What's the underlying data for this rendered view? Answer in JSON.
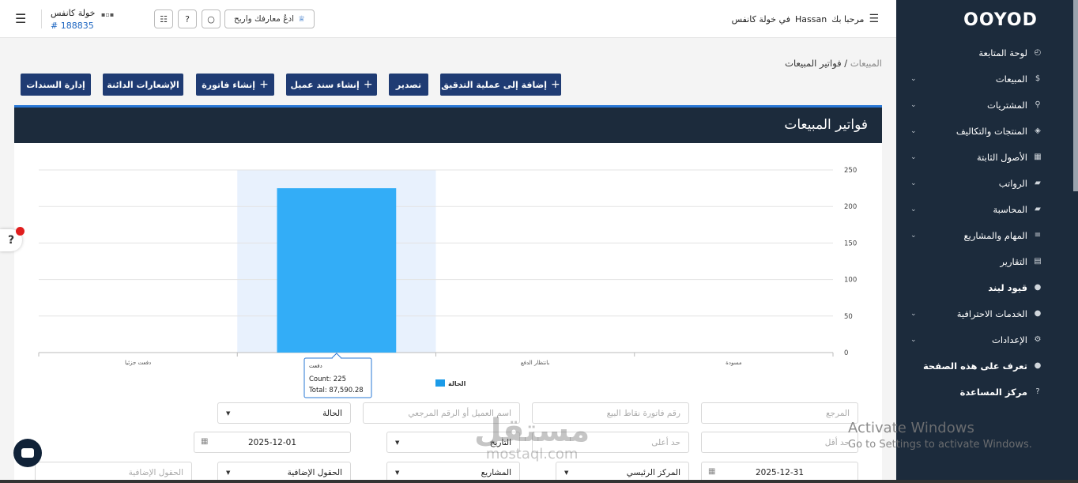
{
  "sidebar": {
    "logo": "OOYOD",
    "items": [
      {
        "label": "لوحة المتابعة",
        "icon": "dashboard-icon",
        "glyph": "◴",
        "chevron": false
      },
      {
        "label": "المبيعات",
        "icon": "dollar-icon",
        "glyph": "$",
        "chevron": true
      },
      {
        "label": "المشتريات",
        "icon": "cart-icon",
        "glyph": "⚲",
        "chevron": true
      },
      {
        "label": "المنتجات والتكاليف",
        "icon": "box-icon",
        "glyph": "◈",
        "chevron": true
      },
      {
        "label": "الأصول الثابتة",
        "icon": "grid-icon",
        "glyph": "▦",
        "chevron": true
      },
      {
        "label": "الرواتب",
        "icon": "folder-icon",
        "glyph": "▰",
        "chevron": true
      },
      {
        "label": "المحاسبة",
        "icon": "folder-icon",
        "glyph": "▰",
        "chevron": true
      },
      {
        "label": "المهام والمشاريع",
        "icon": "tasks-icon",
        "glyph": "≡",
        "chevron": true
      },
      {
        "label": "التقارير",
        "icon": "report-icon",
        "glyph": "▤",
        "chevron": false
      },
      {
        "label": "قيود ليند",
        "icon": "search-icon",
        "glyph": "●",
        "chevron": false,
        "bold": true
      },
      {
        "label": "الخدمات الاحترافية",
        "icon": "search-icon",
        "glyph": "●",
        "chevron": true
      },
      {
        "label": "الإعدادات",
        "icon": "gear-icon",
        "glyph": "⚙",
        "chevron": true
      },
      {
        "label": "تعرف على هذه الصفحة",
        "icon": "search-icon",
        "glyph": "●",
        "chevron": false,
        "bold": true
      },
      {
        "label": "مركز المساعدة",
        "icon": "help-icon",
        "glyph": "?",
        "chevron": false,
        "bold": true
      }
    ]
  },
  "header": {
    "welcome_prefix": "مرحبا بك",
    "user": "Hassan",
    "welcome_suffix": "في خولة كانفس",
    "company": "خولة كانفس",
    "account": "# 188835",
    "learn_button": "ادعُ معارفك واربح"
  },
  "breadcrumb": {
    "parent": "المبيعات",
    "current": "فواتير المبيعات"
  },
  "actions": {
    "add_audit": "إضافة إلى عملية التدقيق",
    "export": "تصدير",
    "create_receipt": "إنشاء سند عميل",
    "create_invoice": "إنشاء فاتورة",
    "recurring": "الإشعارات الدائنة",
    "manage_vouchers": "إدارة السندات"
  },
  "panel": {
    "title": "فواتير المبيعات"
  },
  "chart_data": {
    "type": "bar",
    "categories": [
      "دفعت جزئيا",
      "دفعت",
      "بانتظار الدفع",
      "مسودة"
    ],
    "values": [
      0,
      225,
      0,
      0
    ],
    "ylim": [
      0,
      250
    ],
    "yticks": [
      0,
      50,
      100,
      150,
      200,
      250
    ],
    "legend": "الحالة",
    "bar_color": "#33adf7",
    "highlight_color": "#e8f1fd",
    "tooltip": {
      "title": "دفعت",
      "count": "Count: 225",
      "total": "Total: 87,590.28"
    }
  },
  "filters": {
    "reference": "المرجع",
    "pos_invoice": "رقم فاتورة نقاط البيع",
    "customer": "اسم العميل أو الرقم المرجعي",
    "status": "الحالة",
    "min": "حد أقل",
    "max": "حد أعلى",
    "date_label": "التاريخ",
    "date_from": "2025-12-01",
    "date_to": "2025-12-31",
    "center": "المركز الرئيسي",
    "projects": "المشاريع",
    "extra_fields": "الحقول الإضافية",
    "extra_fields_ph": "الحقول الإضافية"
  },
  "watermark": {
    "activate_title": "Activate Windows",
    "activate_sub": "Go to Settings to activate Windows.",
    "site_ar": "مستقل",
    "site_en": "mostaql.com"
  }
}
